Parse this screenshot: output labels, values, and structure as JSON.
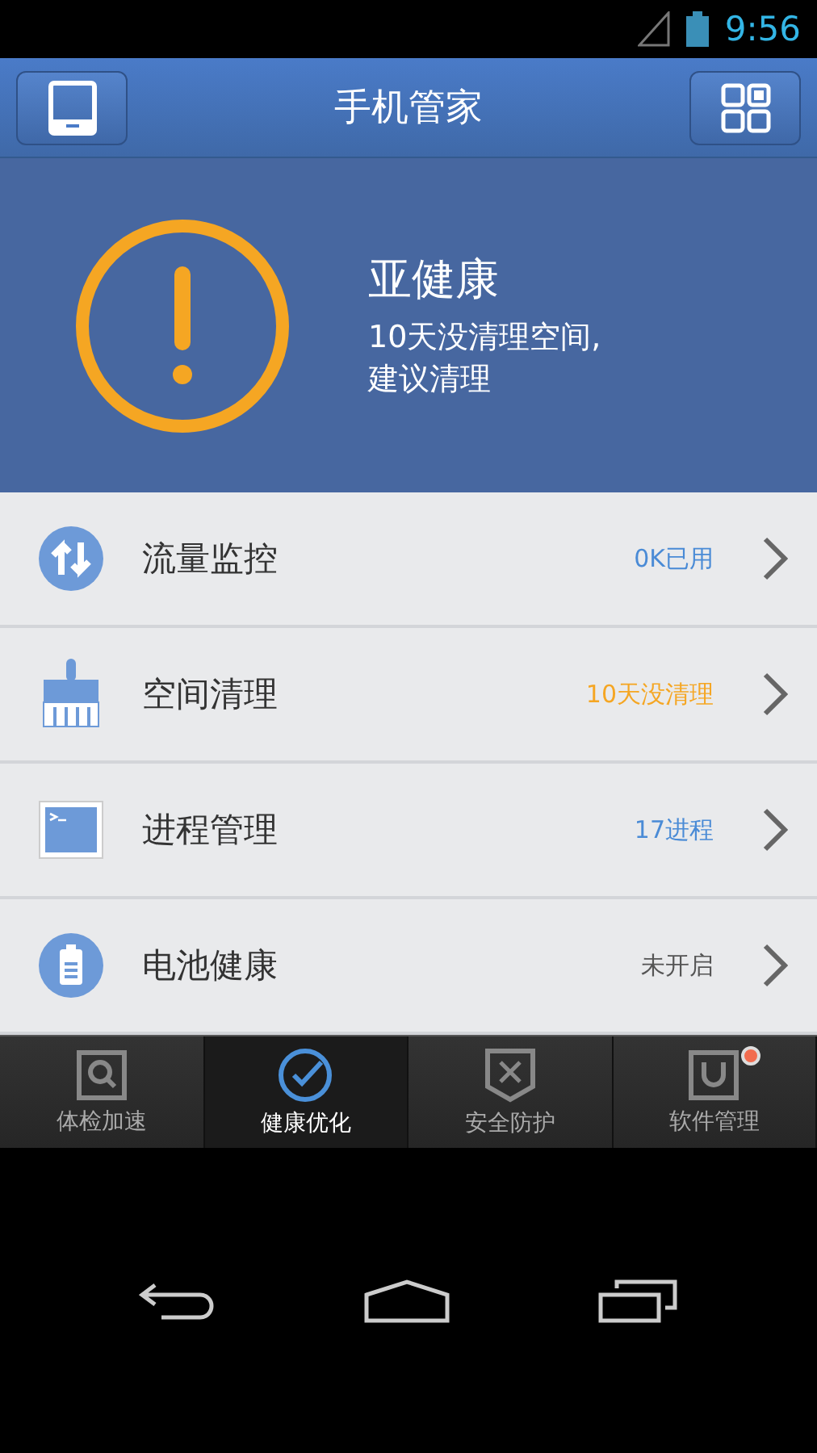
{
  "status_bar": {
    "time": "9:56"
  },
  "header": {
    "title": "手机管家"
  },
  "health": {
    "status": "亚健康",
    "message": "10天没清理空间,\n建议清理"
  },
  "items": [
    {
      "kind": "traffic",
      "label": "流量监控",
      "value": "0K已用",
      "color": "#4a8bd6"
    },
    {
      "kind": "cleanup",
      "label": "空间清理",
      "value": "10天没清理",
      "color": "#f5a623"
    },
    {
      "kind": "process",
      "label": "进程管理",
      "value": "17进程",
      "color": "#4a8bd6"
    },
    {
      "kind": "battery",
      "label": "电池健康",
      "value": "未开启",
      "color": "#555555"
    }
  ],
  "tabs": [
    {
      "kind": "checkup",
      "label": "体检加速",
      "selected": false,
      "badge": false
    },
    {
      "kind": "health",
      "label": "健康优化",
      "selected": true,
      "badge": false
    },
    {
      "kind": "security",
      "label": "安全防护",
      "selected": false,
      "badge": false
    },
    {
      "kind": "software",
      "label": "软件管理",
      "selected": false,
      "badge": true
    }
  ]
}
